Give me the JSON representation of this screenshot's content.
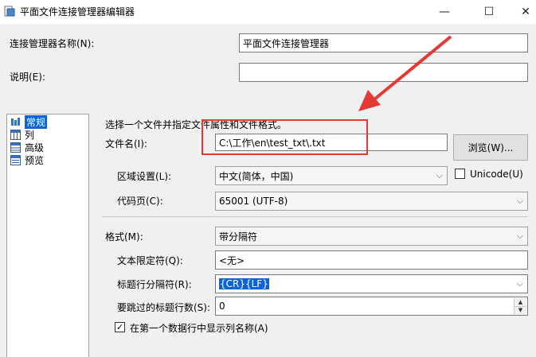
{
  "window": {
    "title": "平面文件连接管理器编辑器",
    "icon": "app-icon",
    "controls": [
      "—",
      "☐",
      "✕"
    ]
  },
  "form": {
    "manager_name_label": "连接管理器名称(N):",
    "manager_name_value": "平面文件连接管理器",
    "description_label": "说明(E):",
    "description_value": ""
  },
  "nav": {
    "items": [
      {
        "label": "常规",
        "icon": "general-icon",
        "selected": true
      },
      {
        "label": "列",
        "icon": "columns-icon",
        "selected": false
      },
      {
        "label": "高级",
        "icon": "advanced-icon",
        "selected": false
      },
      {
        "label": "预览",
        "icon": "preview-icon",
        "selected": false
      }
    ]
  },
  "general": {
    "instruction": "选择一个文件并指定文件属性和文件格式。",
    "filename_label": "文件名(I):",
    "filename_value": "C:\\工作\\en\\test_txt\\.txt",
    "browse_label": "浏览(W)...",
    "locale_label": "区域设置(L):",
    "locale_value": "中文(简体，中国)",
    "unicode_label": "Unicode(U)",
    "unicode_checked": false,
    "codepage_label": "代码页(C):",
    "codepage_value": "65001 (UTF-8)",
    "format_label": "格式(M):",
    "format_value": "带分隔符",
    "text_qualifier_label": "文本限定符(Q):",
    "text_qualifier_value": "<无>",
    "header_delim_label": "标题行分隔符(R):",
    "header_delim_value": "{CR}{LF}",
    "header_skip_label": "要跳过的标题行数(S):",
    "header_skip_value": "0",
    "first_row_names_label": "在第一个数据行中显示列名称(A)",
    "first_row_names_checked": true
  },
  "annotation": {
    "color": "#e53935"
  }
}
